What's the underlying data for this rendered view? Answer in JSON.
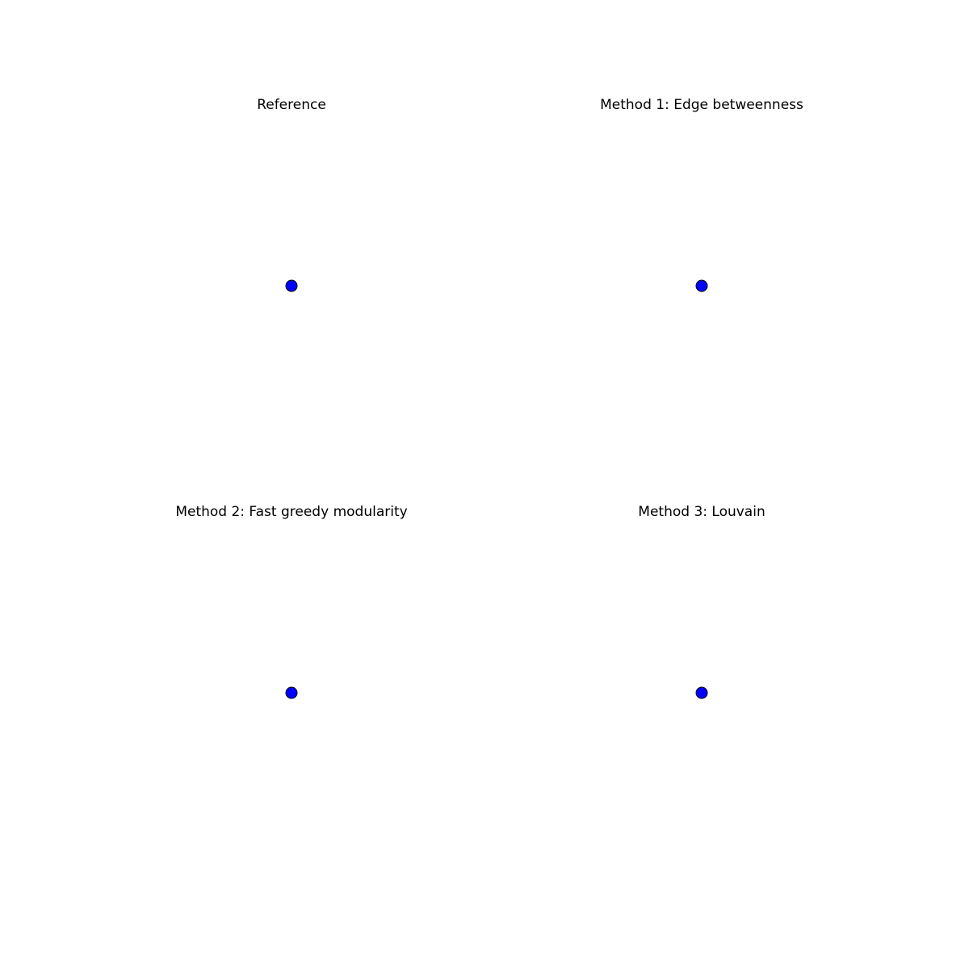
{
  "panels": [
    {
      "title": "Reference",
      "nodes": [
        {
          "color": "#0000ff",
          "stroke": "#000000"
        }
      ]
    },
    {
      "title": "Method 1: Edge betweenness",
      "nodes": [
        {
          "color": "#0000ff",
          "stroke": "#000000"
        }
      ]
    },
    {
      "title": "Method 2: Fast greedy modularity",
      "nodes": [
        {
          "color": "#0000ff",
          "stroke": "#000000"
        }
      ]
    },
    {
      "title": "Method 3: Louvain",
      "nodes": [
        {
          "color": "#0000ff",
          "stroke": "#000000"
        }
      ]
    }
  ]
}
